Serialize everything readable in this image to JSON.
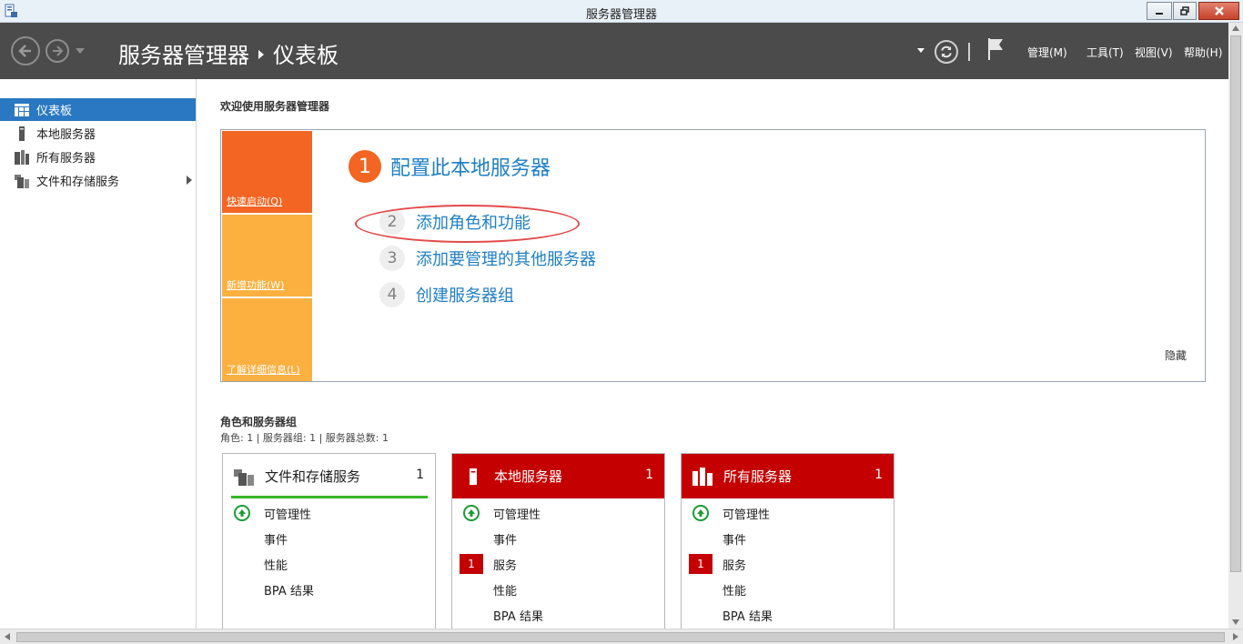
{
  "window": {
    "title": "服务器管理器"
  },
  "header": {
    "breadcrumb": [
      "服务器管理器",
      "仪表板"
    ],
    "menu": [
      {
        "label": "管理(M)"
      },
      {
        "label": "工具(T)"
      },
      {
        "label": "视图(V)"
      },
      {
        "label": "帮助(H)"
      }
    ]
  },
  "sidebar": {
    "items": [
      {
        "label": "仪表板",
        "icon": "dashboard-icon",
        "active": true
      },
      {
        "label": "本地服务器",
        "icon": "server-icon"
      },
      {
        "label": "所有服务器",
        "icon": "servers-icon"
      },
      {
        "label": "文件和存储服务",
        "icon": "file-storage-icon",
        "has_submenu": true
      }
    ]
  },
  "welcome": {
    "title": "欢迎使用服务器管理器",
    "tiles": [
      {
        "label": "快速启动(Q)",
        "color": "#f26522"
      },
      {
        "label": "新增功能(W)",
        "color": "#fbb040"
      },
      {
        "label": "了解详细信息(L)",
        "color": "#fbb040"
      }
    ],
    "steps": [
      {
        "num": "1",
        "label": "配置此本地服务器"
      },
      {
        "num": "2",
        "label": "添加角色和功能"
      },
      {
        "num": "3",
        "label": "添加要管理的其他服务器"
      },
      {
        "num": "4",
        "label": "创建服务器组"
      }
    ],
    "hide_label": "隐藏"
  },
  "roles": {
    "title": "角色和服务器组",
    "summary": "角色: 1 | 服务器组: 1 | 服务器总数: 1",
    "cards": [
      {
        "name": "文件和存储服务",
        "count": "1",
        "status": "ok",
        "rows": [
          {
            "label": "可管理性",
            "indicator": "ok"
          },
          {
            "label": "事件"
          },
          {
            "label": "性能"
          },
          {
            "label": "BPA 结果"
          }
        ]
      },
      {
        "name": "本地服务器",
        "count": "1",
        "status": "alert",
        "rows": [
          {
            "label": "可管理性",
            "indicator": "ok"
          },
          {
            "label": "事件"
          },
          {
            "label": "服务",
            "badge": "1"
          },
          {
            "label": "性能"
          },
          {
            "label": "BPA 结果"
          }
        ]
      },
      {
        "name": "所有服务器",
        "count": "1",
        "status": "alert",
        "rows": [
          {
            "label": "可管理性",
            "indicator": "ok"
          },
          {
            "label": "事件"
          },
          {
            "label": "服务",
            "badge": "1"
          },
          {
            "label": "性能"
          },
          {
            "label": "BPA 结果"
          }
        ]
      }
    ]
  },
  "colors": {
    "header_bg": "#4b4b4b",
    "accent_blue": "#2a78c2",
    "link_blue": "#1f7fc4",
    "alert_red": "#c40000",
    "ok_green": "#38b72a",
    "quickstart_orange": "#f26522",
    "tile_amber": "#fbb040"
  }
}
